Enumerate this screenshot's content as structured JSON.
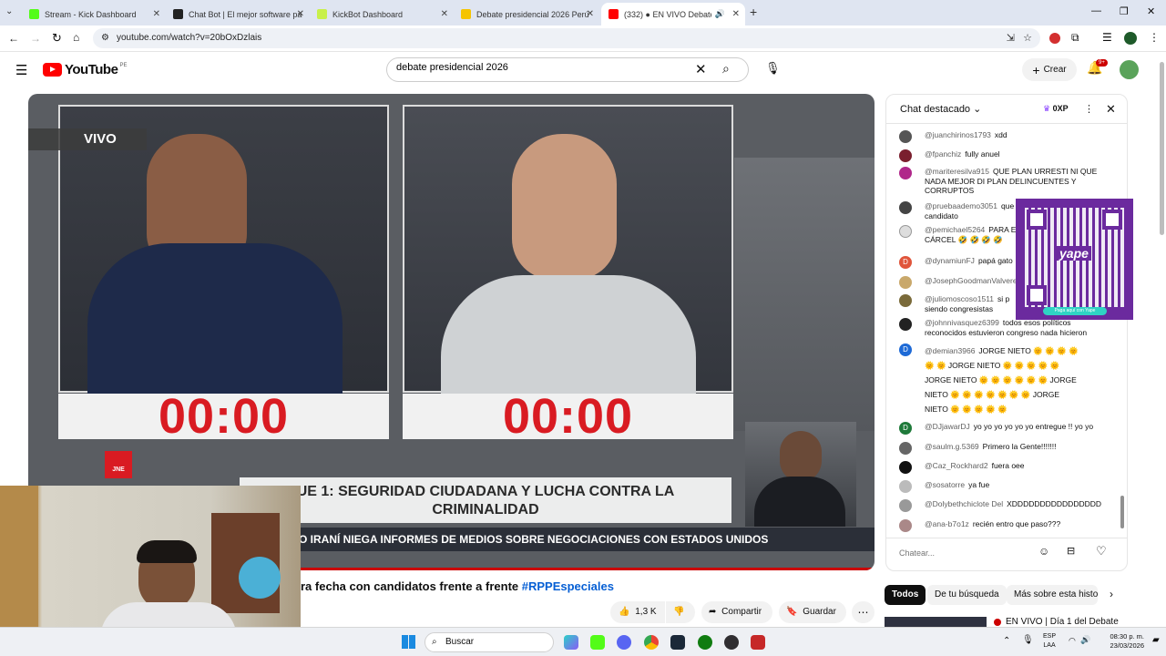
{
  "browser": {
    "tabs": [
      {
        "title": "Stream - Kick Dashboard",
        "color": "#53fc18"
      },
      {
        "title": "Chat Bot | El mejor software pa",
        "color": "#222"
      },
      {
        "title": "KickBot Dashboard",
        "color": "#c8f04a"
      },
      {
        "title": "Debate presidencial 2026 Perú",
        "color": "#f5c400"
      },
      {
        "title": "(332) ● EN VIVO Debate p",
        "color": "#ff0000"
      }
    ],
    "new_tab": "+",
    "url": "youtube.com/watch?v=20bOxDzlais"
  },
  "youtube": {
    "logo_text": "YouTube",
    "country": "PE",
    "search_value": "debate presidencial 2026",
    "create_label": "Crear",
    "notif_count": "9+",
    "avatar_letter": "e"
  },
  "video": {
    "vivo": "VIVO",
    "timer_left": "00:00",
    "timer_right": "00:00",
    "jne": "JNE",
    "bloque": "UE 1: SEGURIDAD CIUDADANA Y LUCHA CONTRA LA",
    "bloque2": "CRIMINALIDAD",
    "ticker": "O IRANÍ NIEGA INFORMES DE MEDIOS SOBRE NEGOCIACIONES CON ESTADOS UNIDOS"
  },
  "below": {
    "title_text": "ra fecha con candidatos frente a frente",
    "hashtag": "#RPPEspeciales",
    "likes": "1,3 K",
    "share": "Compartir",
    "save": "Guardar",
    "chips": [
      "Todos",
      "De tu búsqueda",
      "Más sobre esta histor"
    ],
    "next_video": "EN VIVO | Día 1 del Debate"
  },
  "chat": {
    "header": "Chat destacado",
    "xp": "0XP",
    "placeholder": "Chatear...",
    "messages": [
      {
        "user": "@juanchirinos1793",
        "text": "xdd"
      },
      {
        "user": "@fpanchiz",
        "text": "fully anuel"
      },
      {
        "user": "@mariteresilva915",
        "text": "QUE PLAN URRESTI NI QUE NADA MEJOR DI PLAN DELINCUENTES Y CORRUPTOS"
      },
      {
        "user": "@pruebaademo3051",
        "text": "que candidato"
      },
      {
        "user": "@pemichael5264",
        "text": "PARA E CÁRCEL 🤣 🤣 🤣 🤣"
      },
      {
        "user": "@dynamiunFJ",
        "text": "papá gato"
      },
      {
        "user": "@JosephGoodmanValvere",
        "text": ""
      },
      {
        "user": "@juliomoscoso1511",
        "text": "si p siendo congresistas"
      },
      {
        "user": "@johnnivasquez6399",
        "text": "todos esos políticos reconocidos estuvieron congreso nada hicieron"
      },
      {
        "user": "@demian3966",
        "text": "JORGE NIETO 🌞 🌞 🌞 🌞 🌞 🌞 JORGE NIETO 🌞 🌞 🌞 🌞 🌞 JORGE NIETO 🌞 🌞 🌞 🌞 🌞 🌞 JORGE NIETO 🌞 🌞 🌞 🌞 🌞 🌞 🌞 JORGE NIETO 🌞 🌞 🌞 🌞 🌞"
      },
      {
        "user": "@DJjawarDJ",
        "text": "yo yo yo yo yo yo entregue !! yo yo"
      },
      {
        "user": "@saulm.g.5369",
        "text": "Primero la Gente!!!!!!!"
      },
      {
        "user": "@Caz_Rockhard2",
        "text": "fuera oee"
      },
      {
        "user": "@sosatorre",
        "text": "ya fue"
      },
      {
        "user": "@Dolybethchiclote Del",
        "text": "XDDDDDDDDDDDDDDDD"
      },
      {
        "user": "@ana-b7o1z",
        "text": "recién entro que paso???"
      }
    ],
    "qr_caption": "Paga aquí con Yape",
    "qr_logo": "yape"
  },
  "taskbar": {
    "search": "Buscar",
    "lang1": "ESP",
    "lang2": "LAA",
    "time": "08:30 p. m.",
    "date": "23/03/2026"
  }
}
